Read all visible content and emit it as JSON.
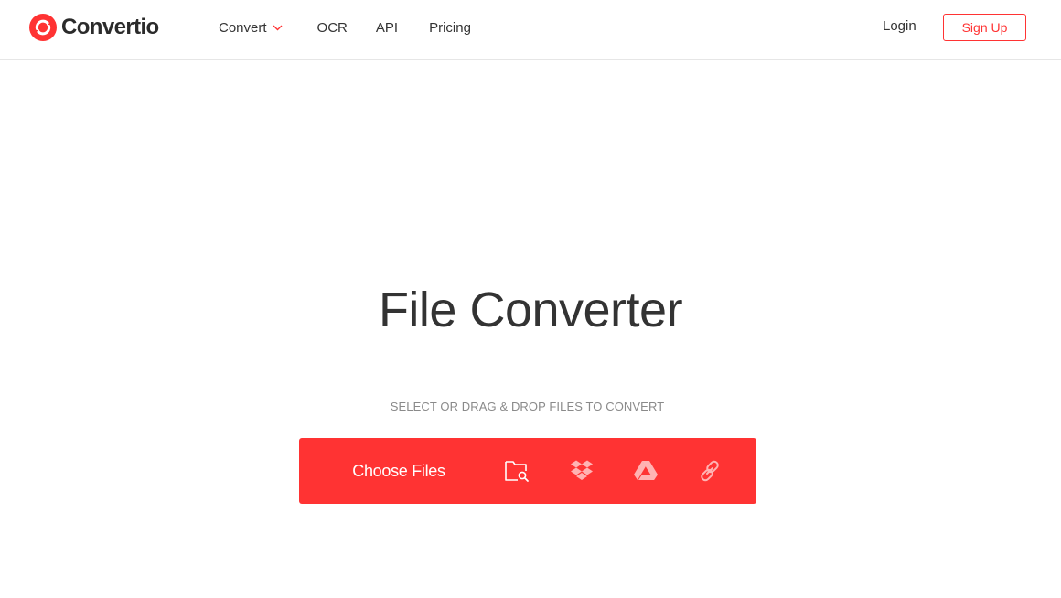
{
  "brand": {
    "name": "Convertio",
    "color": "#ff3333"
  },
  "nav": {
    "convert": "Convert",
    "ocr": "OCR",
    "api": "API",
    "pricing": "Pricing"
  },
  "auth": {
    "login": "Login",
    "signup": "Sign Up"
  },
  "hero": {
    "title": "File Converter",
    "subtitle": "SELECT OR DRAG & DROP FILES TO CONVERT"
  },
  "upload": {
    "choose_label": "Choose Files",
    "sources": [
      {
        "icon": "folder-search-icon"
      },
      {
        "icon": "dropbox-icon"
      },
      {
        "icon": "google-drive-icon"
      },
      {
        "icon": "link-icon"
      }
    ]
  }
}
